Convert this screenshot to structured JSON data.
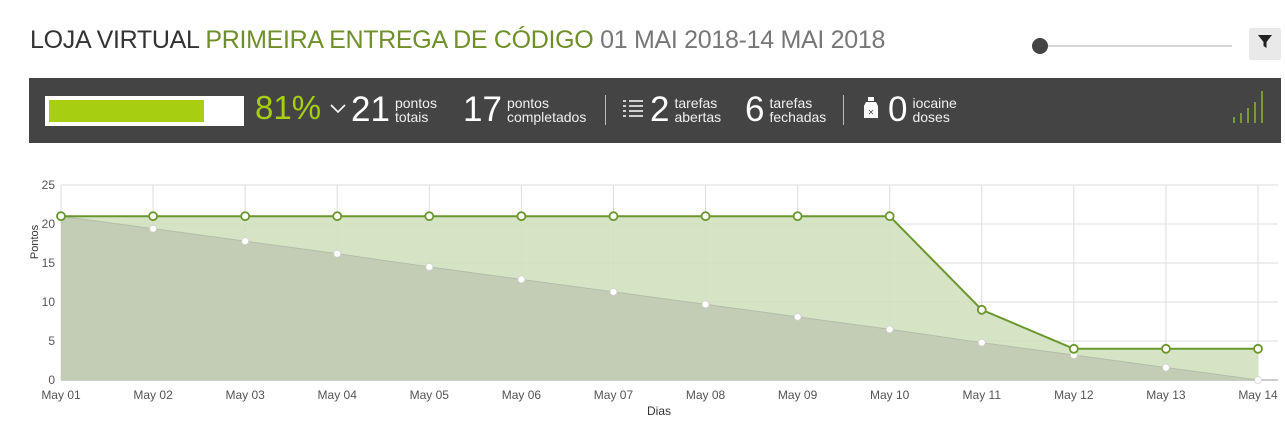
{
  "header": {
    "project": "LOJA VIRTUAL",
    "sprint": "PRIMEIRA ENTREGA DE CÓDIGO",
    "dates": "01 MAI 2018-14 MAI 2018"
  },
  "icons": {
    "filter": "filter-icon",
    "chevron": "chevron-down-icon",
    "tasks": "list-icon",
    "iocaine": "iocaine-bottle-icon",
    "graph": "graph-bars-icon"
  },
  "stats": {
    "progress_fraction": 0.81,
    "percent": "81%",
    "total_points": {
      "value": "21",
      "line1": "pontos",
      "line2": "totais"
    },
    "completed_points": {
      "value": "17",
      "line1": "pontos",
      "line2": "completados"
    },
    "open_tasks": {
      "value": "2",
      "line1": "tarefas",
      "line2": "abertas"
    },
    "closed_tasks": {
      "value": "6",
      "line1": "tarefas",
      "line2": "fechadas"
    },
    "iocaine": {
      "value": "0",
      "line1": "iocaine",
      "line2": "doses"
    }
  },
  "colors": {
    "accent_green": "#a7ce10",
    "real_line": "#6a962e",
    "real_fill": "#d2e1c0",
    "ideal_fill": "#bfc8b0",
    "bar_bg": "#444444"
  },
  "chart_data": {
    "type": "area",
    "x": [
      "May 01",
      "May 02",
      "May 03",
      "May 04",
      "May 05",
      "May 06",
      "May 07",
      "May 08",
      "May 09",
      "May 10",
      "May 11",
      "May 12",
      "May 13",
      "May 14"
    ],
    "series": [
      {
        "values": [
          21,
          21,
          21,
          21,
          21,
          21,
          21,
          21,
          21,
          21,
          9,
          4,
          4,
          4
        ]
      },
      {
        "values": [
          21,
          19.4,
          17.8,
          16.2,
          14.5,
          12.9,
          11.3,
          9.7,
          8.1,
          6.5,
          4.8,
          3.2,
          1.6,
          0
        ]
      }
    ],
    "xlabel": "Dias",
    "ylabel": "Pontos",
    "ylim": [
      0,
      25
    ],
    "yticks": [
      "0",
      "5",
      "10",
      "15",
      "20",
      "25"
    ],
    "grid": true
  }
}
